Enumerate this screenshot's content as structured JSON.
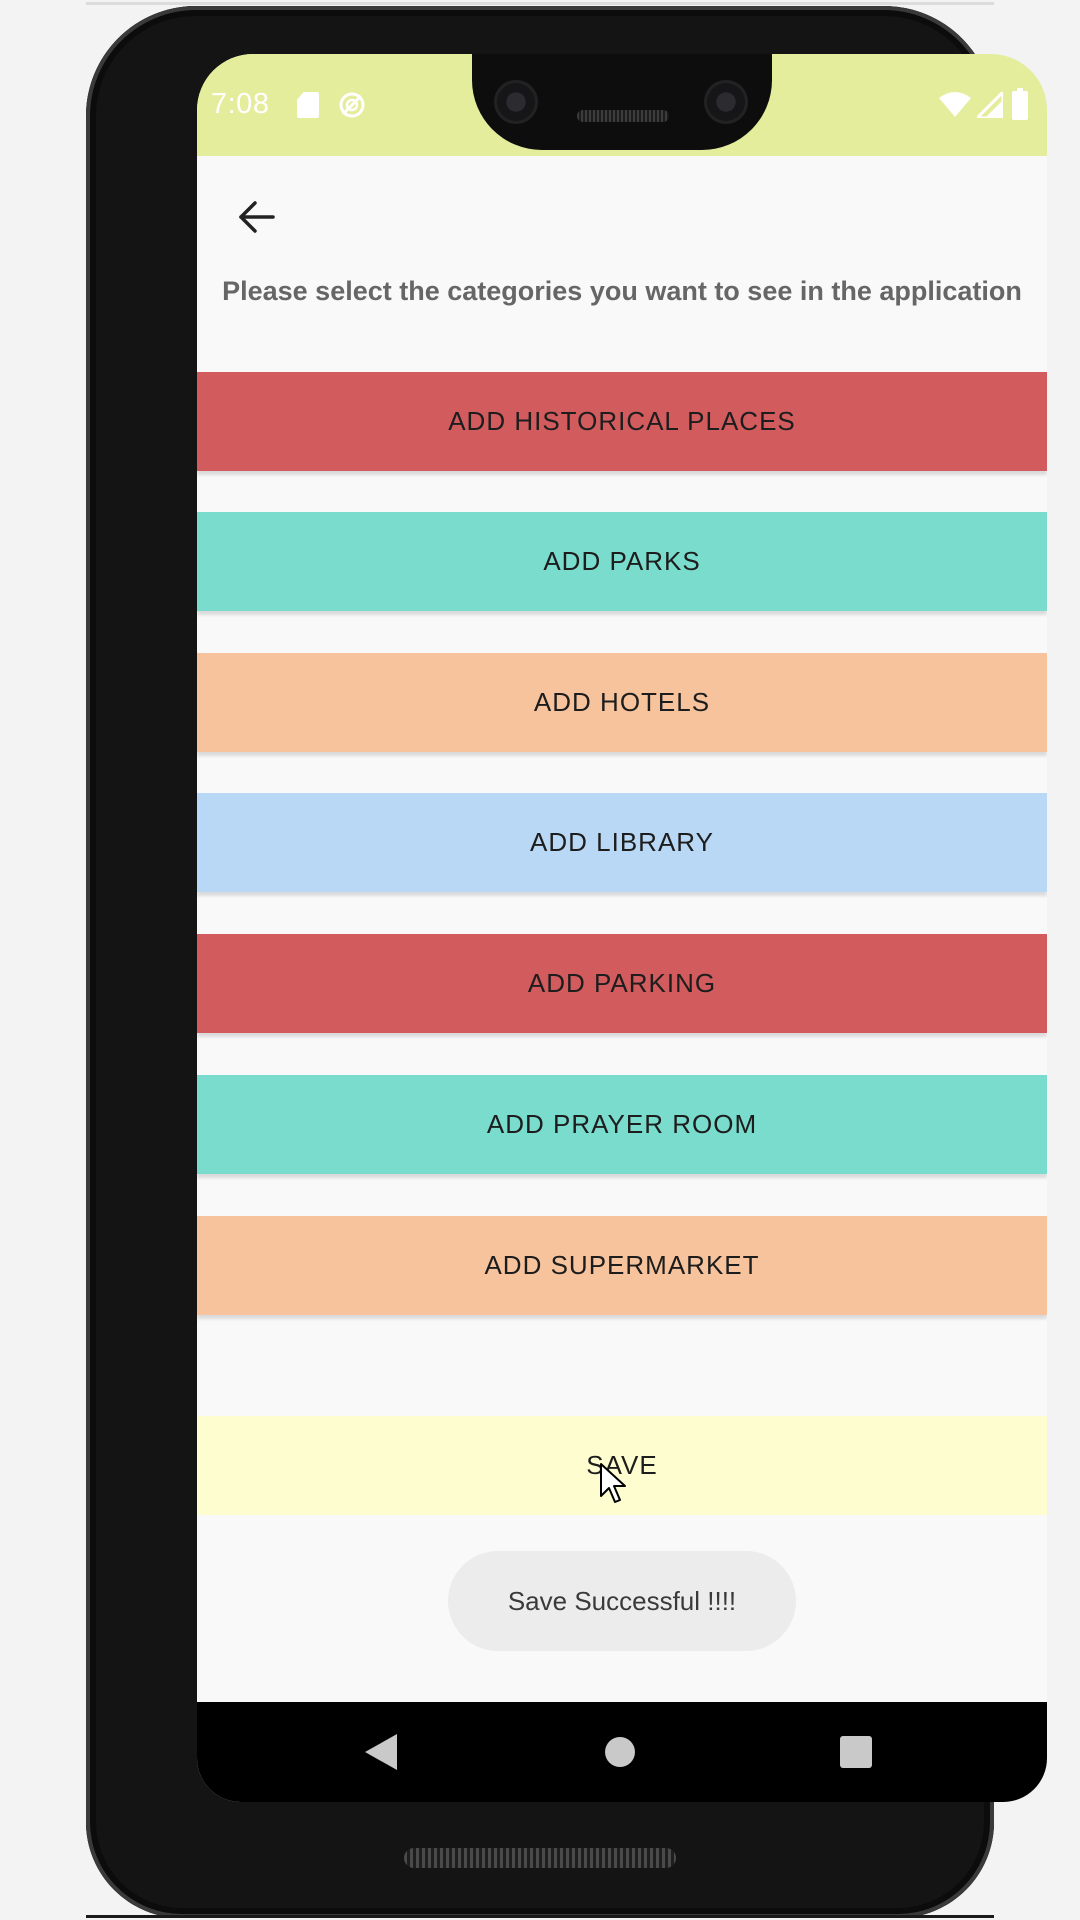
{
  "statusbar": {
    "time": "7:08",
    "icons": [
      "sd-card-icon",
      "sync-icon",
      "wifi-icon",
      "signal-icon",
      "battery-icon"
    ],
    "background": "#e3ed9b"
  },
  "header": {
    "back_icon": "back-arrow-icon",
    "instruction": "Please select the categories you want to see in the application"
  },
  "categories": [
    {
      "label": "ADD HISTORICAL PLACES",
      "color": "#d15b5d"
    },
    {
      "label": "ADD PARKS",
      "color": "#79dccd"
    },
    {
      "label": "ADD HOTELS",
      "color": "#f7c39d"
    },
    {
      "label": "ADD LIBRARY",
      "color": "#b9d8f5"
    },
    {
      "label": "ADD PARKING",
      "color": "#d15b5d"
    },
    {
      "label": "ADD PRAYER ROOM",
      "color": "#79dccd"
    },
    {
      "label": "ADD SUPERMARKET",
      "color": "#f7c39d"
    }
  ],
  "save": {
    "label": "SAVE",
    "color": "#fdfdd0"
  },
  "toast": {
    "message": "Save Successful !!!!"
  },
  "navbar": {
    "icons": [
      "nav-back-icon",
      "nav-home-icon",
      "nav-recents-icon"
    ]
  }
}
